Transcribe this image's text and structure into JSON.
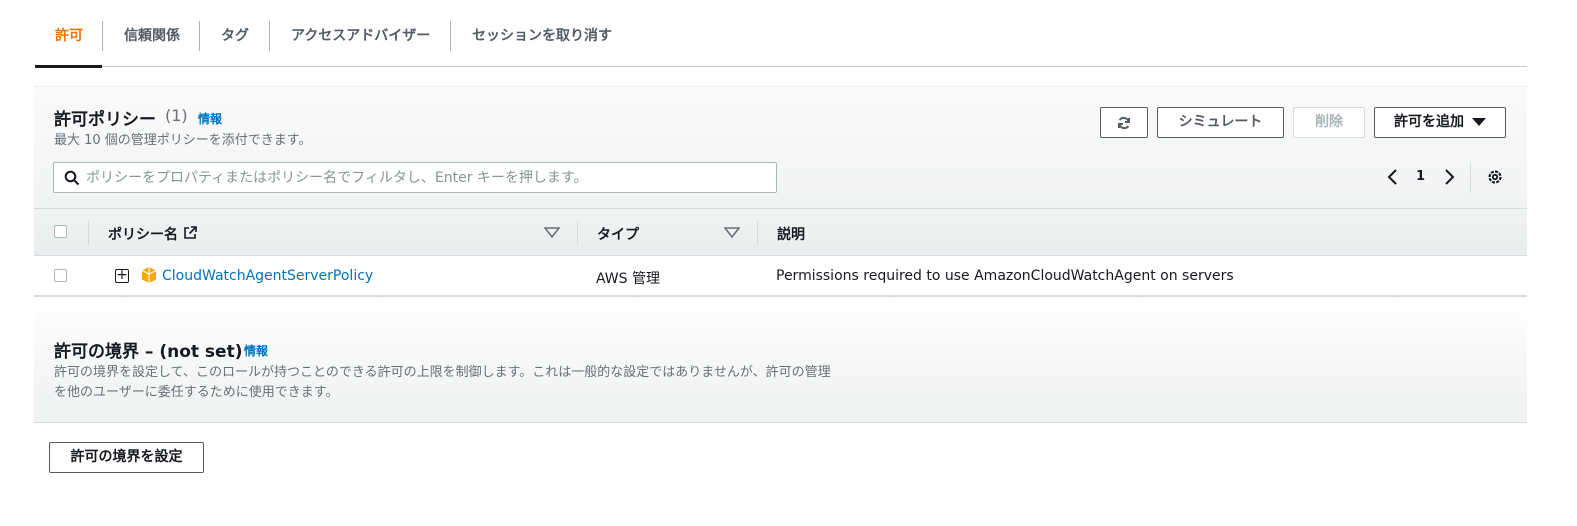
{
  "tabs": [
    {
      "label": "許可",
      "active": true
    },
    {
      "label": "信頼関係"
    },
    {
      "label": "タグ"
    },
    {
      "label": "アクセスアドバイザー"
    },
    {
      "label": "セッションを取り消す"
    }
  ],
  "policies": {
    "title": "許可ポリシー",
    "count": "(1)",
    "info": "情報",
    "description": "最大 10 個の管理ポリシーを添付できます。",
    "buttons": {
      "simulate": "シミュレート",
      "delete": "削除",
      "add": "許可を追加"
    },
    "search_placeholder": "ポリシーをプロパティまたはポリシー名でフィルタし、Enter キーを押します。",
    "page": "1",
    "columns": [
      "ポリシー名",
      "タイプ",
      "説明"
    ],
    "rows": [
      {
        "name": "CloudWatchAgentServerPolicy",
        "type": "AWS 管理",
        "description": "Permissions required to use AmazonCloudWatchAgent on servers"
      }
    ]
  },
  "boundary": {
    "title": "許可の境界 – (not set)",
    "info": "情報",
    "description_line1": "許可の境界を設定して、このロールが持つことのできる許可の上限を制御します。これは一般的な設定ではありませんが、許可の管理",
    "description_line2": "を他のユーザーに委任するために使用できます。",
    "set_button": "許可の境界を設定"
  },
  "colors": {
    "accent": "#ec7211",
    "link": "#0073bb",
    "text": "#16191f",
    "muted": "#687078"
  }
}
